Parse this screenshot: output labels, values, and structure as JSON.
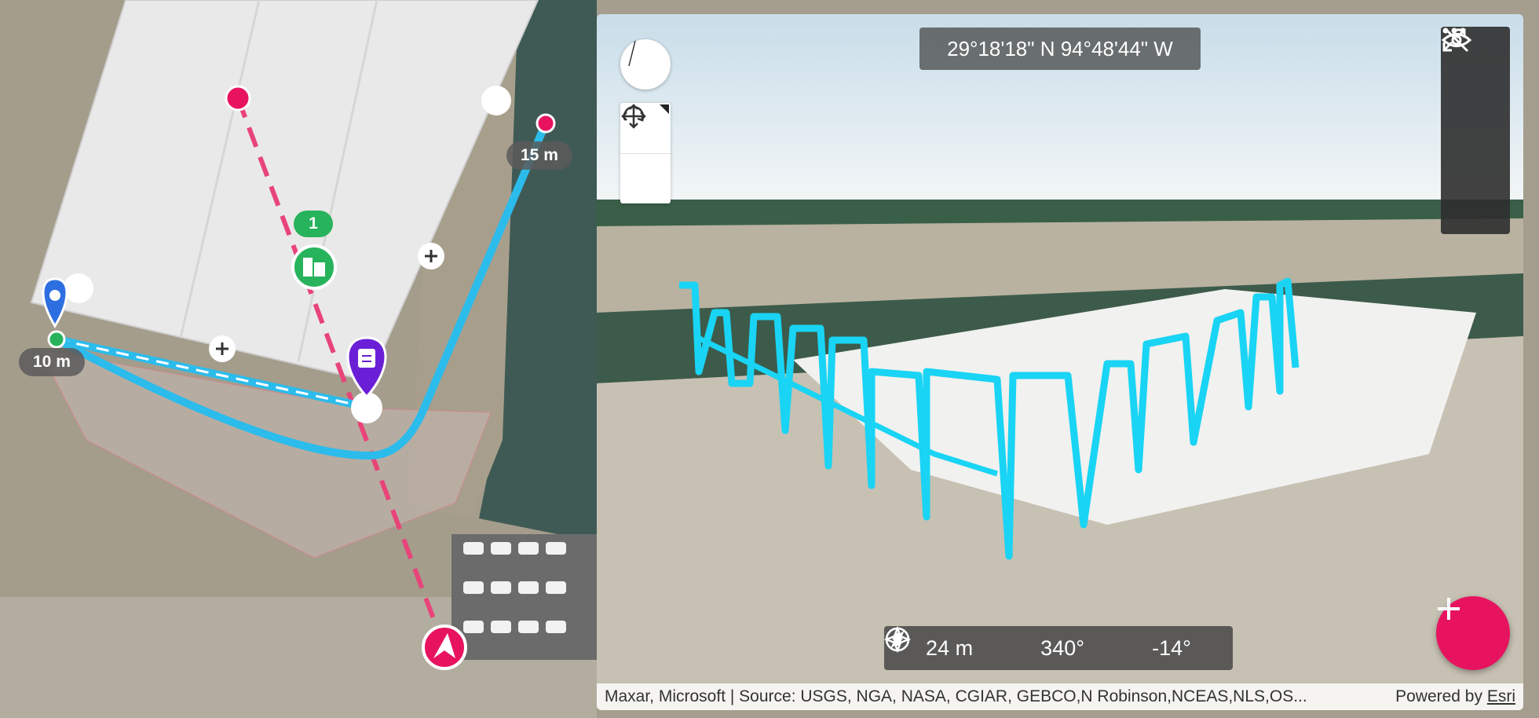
{
  "map2d": {
    "distance_labels": [
      "15 m",
      "10 m"
    ],
    "cluster_badge": "1",
    "colors": {
      "flight_path": "#2bbcec",
      "direction_line": "#e8447a",
      "waypoint_red": "#e8135f",
      "home_marker": "#2d6fe0",
      "task_marker": "#6a1fd6",
      "cluster_green": "#27b35c"
    },
    "icons": [
      "location-pin-icon",
      "clipboard-icon",
      "building-icon",
      "plus-icon",
      "navigation-arrow-icon"
    ]
  },
  "view3d": {
    "coordinates": "29°18'18\" N 94°48'44\" W",
    "stats": {
      "altitude": "24 m",
      "heading": "340°",
      "tilt": "-14°"
    },
    "attribution": {
      "source": "Maxar, Microsoft | Source: USGS, NGA, NASA, CGIAR, GEBCO,N Robinson,NCEAS,NLS,OS...",
      "powered_prefix": "Powered by ",
      "powered_link": "Esri"
    },
    "icons": [
      "compass-icon",
      "pan-icon",
      "rotate-icon",
      "hide-icon",
      "expand-icon",
      "more-icon",
      "add-icon",
      "altitude-icon",
      "heading-icon",
      "tilt-icon"
    ],
    "colors": {
      "fab": "#e8135f",
      "flight_path_3d": "#19d4f4"
    }
  }
}
